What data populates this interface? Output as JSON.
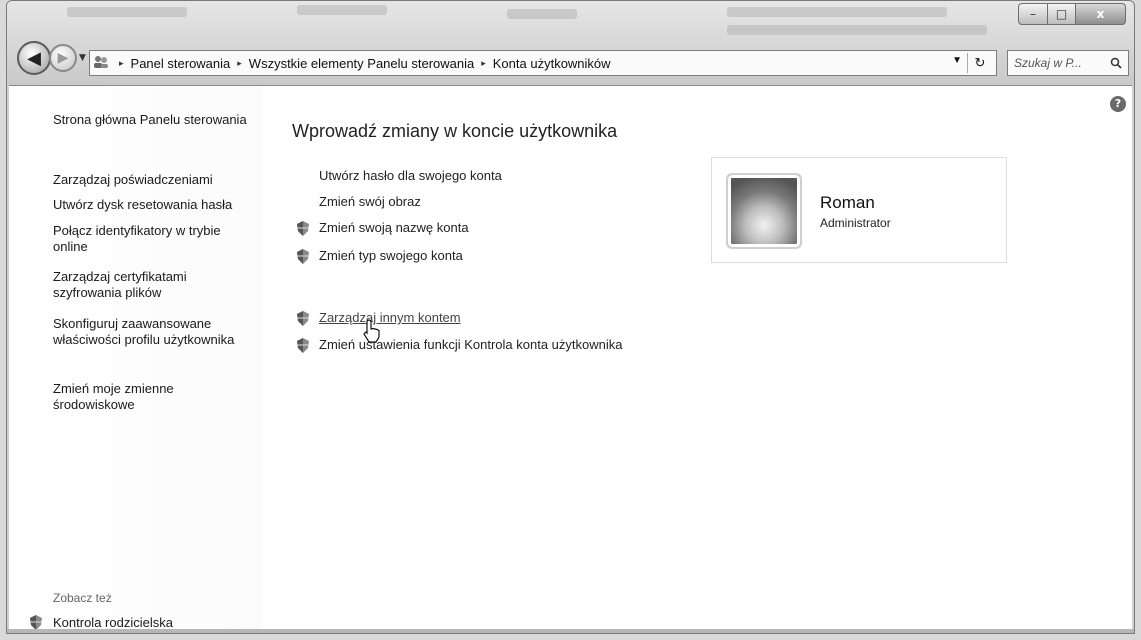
{
  "window": {
    "caption": {
      "minimize": "–",
      "maximize": "□",
      "close": "x"
    }
  },
  "nav": {
    "back_glyph": "◀",
    "forward_glyph": "▶",
    "dropdown_glyph": "▼"
  },
  "address": {
    "crumbs": [
      "Panel sterowania",
      "Wszystkie elementy Panelu sterowania",
      "Konta użytkowników"
    ],
    "separator": "▸",
    "refresh_glyph": "↻"
  },
  "search": {
    "placeholder": "Szukaj w P...",
    "icon": "search-icon"
  },
  "help": {
    "glyph": "?"
  },
  "sidebar": {
    "items": [
      {
        "label": "Strona główna Panelu sterowania"
      },
      {
        "label": "Zarządzaj poświadczeniami"
      },
      {
        "label": "Utwórz dysk resetowania hasła"
      },
      {
        "label": "Połącz identyfikatory w trybie online"
      },
      {
        "label": "Zarządzaj certyfikatami szyfrowania plików"
      },
      {
        "label": "Skonfiguruj zaawansowane właściwości profilu użytkownika"
      },
      {
        "label": "Zmień moje zmienne środowiskowe"
      }
    ],
    "see_also": "Zobacz też",
    "parental": "Kontrola rodzicielska"
  },
  "main": {
    "title": "Wprowadź zmiany w koncie użytkownika",
    "tasks": [
      {
        "label": "Utwórz hasło dla swojego konta",
        "shield": false
      },
      {
        "label": "Zmień swój obraz",
        "shield": false
      },
      {
        "label": "Zmień swoją nazwę konta",
        "shield": true
      },
      {
        "label": "Zmień typ swojego konta",
        "shield": true
      },
      {
        "label": "Zarządzaj innym kontem",
        "shield": true
      },
      {
        "label": "Zmień ustawienia funkcji Kontrola konta użytkownika",
        "shield": true
      }
    ]
  },
  "user": {
    "name": "Roman",
    "role": "Administrator"
  }
}
